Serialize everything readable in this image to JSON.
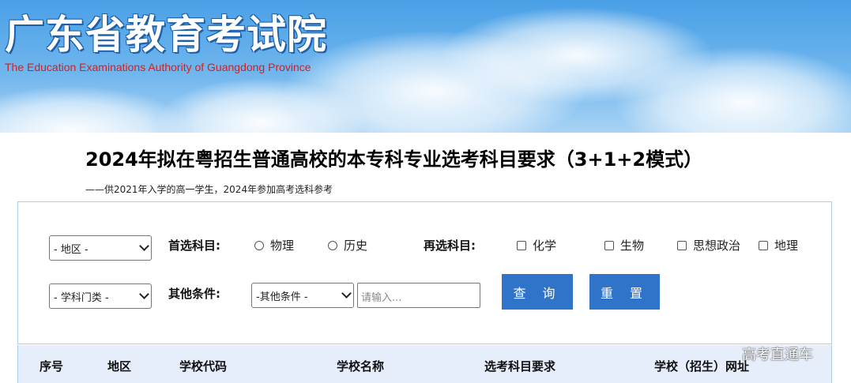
{
  "header": {
    "site_name": "广东省教育考试院",
    "site_name_en": "The Education Examinations Authority of Guangdong Province"
  },
  "page": {
    "title": "2024年拟在粤招生普通高校的本专科专业选考科目要求（3+1+2模式）",
    "subtitle": "——供2021年入学的高一学生，2024年参加高考选科参考"
  },
  "filters": {
    "region_select": "- 地区 -",
    "category_select": "- 学科门类 -",
    "first_subject_label": "首选科目:",
    "first_subject_options": [
      "物理",
      "历史"
    ],
    "second_subject_label": "再选科目:",
    "second_subject_options": [
      "化学",
      "生物",
      "思想政治",
      "地理"
    ],
    "other_label": "其他条件:",
    "other_select": "-其他条件 -",
    "search_placeholder": "请输入...",
    "query_button": "查 询",
    "reset_button": "重 置"
  },
  "table": {
    "columns": [
      "序号",
      "地区",
      "学校代码",
      "学校名称",
      "选考科目要求",
      "学校（招生）网址"
    ]
  },
  "watermark": "高考直通车",
  "colors": {
    "button_blue": "#2f74c8",
    "title_red": "#d81e1e",
    "header_bg": "#e6eefb",
    "banner_blue": "#4aa0e6"
  }
}
